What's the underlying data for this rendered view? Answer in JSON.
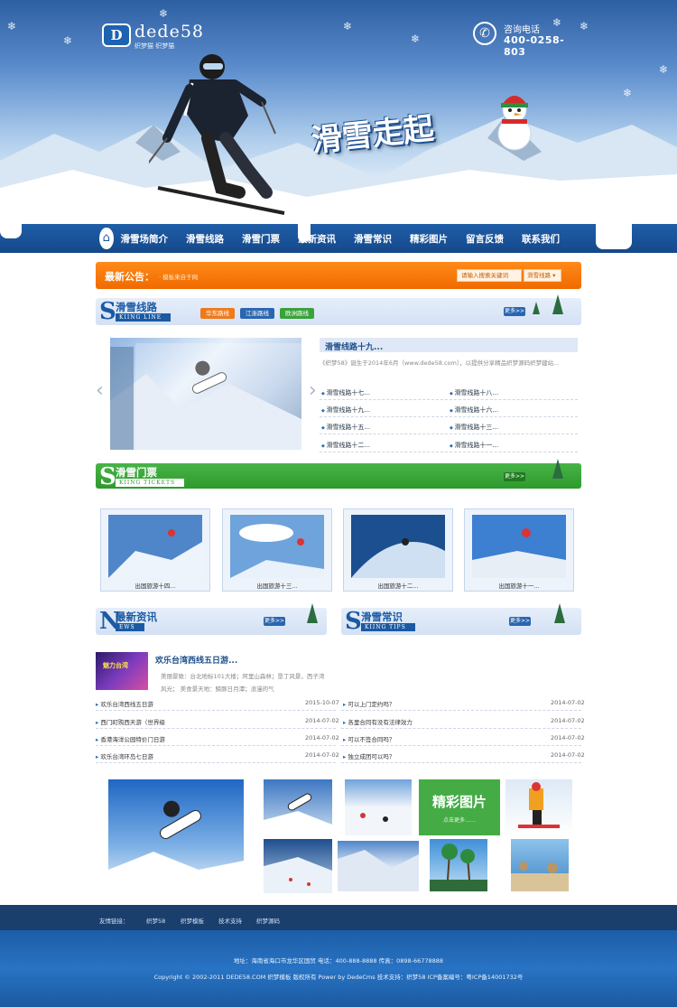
{
  "header": {
    "logo_mark": "D",
    "logo_brand": "dede58",
    "logo_sub": "织梦猫  织梦猫",
    "phone_label": "咨询电话",
    "phone_number": "400-0258-803",
    "slogan": "滑雪走起"
  },
  "nav": {
    "items": [
      "滑雪场简介",
      "滑雪线路",
      "滑雪门票",
      "最新资讯",
      "滑雪常识",
      "精彩图片",
      "留言反馈",
      "联系我们"
    ]
  },
  "notice": {
    "title": "最新公告：",
    "text": "·  模板来自于网",
    "search_placeholder": "请输入搜索关键词",
    "select_value": "滑雪线路"
  },
  "lines": {
    "cn": "滑雪线路",
    "en": "KIING LINE",
    "letter": "S",
    "more": "更多>>",
    "tags": [
      "华东路线",
      "江浙路线",
      "欧洲路线"
    ],
    "featured_title": "滑雪线路十九...",
    "featured_desc": "《织梦58》诞生于2014年6月（www.dede58.com），以提供分享精品织梦源码织梦建站...",
    "left_list": [
      "滑雪线路十七...",
      "滑雪线路十九...",
      "滑雪线路十五...",
      "滑雪线路十二..."
    ],
    "right_list": [
      "滑雪线路十八...",
      "滑雪线路十六...",
      "滑雪线路十三...",
      "滑雪线路十一..."
    ]
  },
  "tickets": {
    "cn": "滑雪门票",
    "en": "KIING TICKETS",
    "letter": "S",
    "more": "更多>>",
    "items": [
      "出国旅游十四...",
      "出国旅游十三...",
      "出国旅游十二...",
      "出国旅游十一..."
    ]
  },
  "news": {
    "cn": "最新资讯",
    "en": "EWS",
    "letter": "N",
    "more": "更多>>",
    "featured_title": "欢乐台湾西线五日游...",
    "featured_desc": "美丽景致：台北地标101大楼；阿里山森林；垦丁风景，西子湾风光；  美食景天地：鲸豚日月潭；浪漫的气",
    "thumb_text": "魅力台湾",
    "items": [
      {
        "title": "欢乐台湾西线五日游",
        "date": "2015-10-07"
      },
      {
        "title": "西门町购西天游（世界级",
        "date": "2014-07-02"
      },
      {
        "title": "香港海洋公园特价门日游",
        "date": "2014-07-02"
      },
      {
        "title": "欢乐台湾环岛七日游",
        "date": "2014-07-02"
      }
    ]
  },
  "tips": {
    "cn": "滑雪常识",
    "en": "KIING TIPS",
    "letter": "S",
    "more": "更多>>",
    "items": [
      {
        "title": "可以上门定约吗？",
        "date": "2014-07-02"
      },
      {
        "title": "各里合同有没有法律效力",
        "date": "2014-07-02"
      },
      {
        "title": "可以不签合同吗？",
        "date": "2014-07-02"
      },
      {
        "title": "独立成团可以吗？",
        "date": "2014-07-02"
      }
    ]
  },
  "gallery": {
    "title": "精彩图片",
    "more": "点击更多……"
  },
  "links": {
    "label": "友情链接：",
    "items": [
      "织梦58",
      "织梦模板",
      "技术支持",
      "织梦源码"
    ]
  },
  "footer": {
    "line1": "地址：海南省海口市龙华区国贸    电话：400-888-8888    传真：0898-66778888",
    "line2": "Copyright © 2002-2011 DEDE58.COM 织梦模板 版权所有 Power by DedeCms    技术支持：织梦58    ICP备案编号：粤ICP备14001732号"
  },
  "colors": {
    "brand_blue": "#1b5aa3",
    "notice_orange": "#f47a0a",
    "ticket_green": "#3aa23a"
  }
}
